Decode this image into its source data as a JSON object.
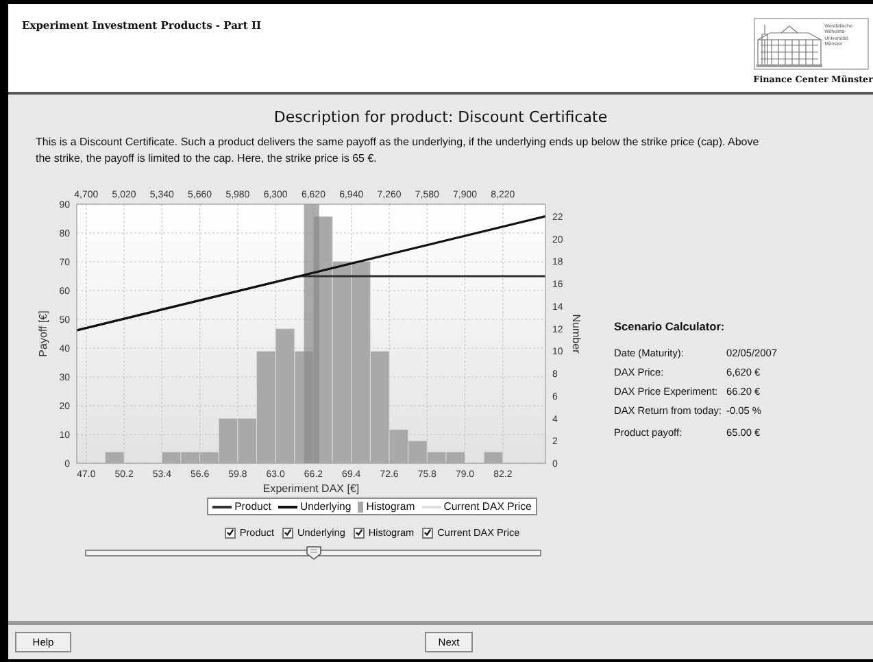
{
  "window": {
    "title": "Experiment Investment Products - Part II"
  },
  "logo": {
    "lines": [
      "Westfälische",
      "Wilhelms-Universität",
      "Münster"
    ],
    "caption": "Finance Center Münster"
  },
  "heading": "Description for product: Discount Certificate",
  "description": "This is a Discount Certificate. Such a product delivers the same payoff as the underlying, if the underlying ends up below the strike price (cap). Above the strike, the payoff is limited to the cap. Here, the strike price is 65 €.",
  "histogram": {
    "chart_data": {
      "type": "bar",
      "xlabel": "Experiment DAX [€]",
      "ylabel": "Number",
      "x": [
        47.8,
        49.4,
        51.0,
        52.6,
        54.2,
        55.8,
        57.4,
        59.0,
        60.6,
        62.2,
        63.8,
        65.4,
        67.0,
        68.6,
        70.2,
        71.8,
        73.4,
        75.0,
        76.6,
        78.2,
        79.8,
        81.4,
        83.0,
        84.6
      ],
      "series": [
        {
          "name": "Histogram",
          "color": "#a9a9a9",
          "values": [
            0,
            1,
            0,
            0,
            1,
            1,
            1,
            4,
            4,
            10,
            12,
            10,
            22,
            18,
            18,
            10,
            3,
            2,
            1,
            1,
            0,
            1,
            0,
            0
          ]
        }
      ],
      "xlim": [
        46.2,
        85.8
      ],
      "ylim": [
        0,
        23.1
      ],
      "xticks": [
        {
          "value": 47.0,
          "label": "47.0"
        },
        {
          "value": 50.2,
          "label": "50.2"
        },
        {
          "value": 53.4,
          "label": "53.4"
        },
        {
          "value": 56.6,
          "label": "56.6"
        },
        {
          "value": 59.8,
          "label": "59.8"
        },
        {
          "value": 63.0,
          "label": "63.0"
        },
        {
          "value": 66.2,
          "label": "66.2"
        },
        {
          "value": 69.4,
          "label": "69.4"
        },
        {
          "value": 72.6,
          "label": "72.6"
        },
        {
          "value": 75.8,
          "label": "75.8"
        },
        {
          "value": 79.0,
          "label": "79.0"
        },
        {
          "value": 82.2,
          "label": "82.2"
        }
      ],
      "yticks": [
        0,
        2,
        4,
        6,
        8,
        10,
        12,
        14,
        16,
        18,
        20,
        22
      ],
      "ref_lines": [
        {
          "axis": "x",
          "value": 66.2,
          "label": "Current DAX Price"
        }
      ]
    }
  },
  "payoff_chart": {
    "chart_data": {
      "type": "line",
      "ylabel": "Payoff [€]",
      "x": [
        4620,
        6500,
        8580
      ],
      "series": [
        {
          "name": "Product",
          "color": "#333333",
          "values": [
            46.2,
            65,
            65
          ]
        },
        {
          "name": "Underlying",
          "color": "#111111",
          "values": [
            46.2,
            65,
            85.8
          ]
        }
      ],
      "xlim": [
        4620,
        8580
      ],
      "ylim": [
        0,
        90
      ],
      "grid": true,
      "xticks": [
        {
          "value": 4700,
          "label": "4,700"
        },
        {
          "value": 5020,
          "label": "5,020"
        },
        {
          "value": 5340,
          "label": "5,340"
        },
        {
          "value": 5660,
          "label": "5,660"
        },
        {
          "value": 5980,
          "label": "5,980"
        },
        {
          "value": 6300,
          "label": "6,300"
        },
        {
          "value": 6620,
          "label": "6,620"
        },
        {
          "value": 6940,
          "label": "6,940"
        },
        {
          "value": 7260,
          "label": "7,260"
        },
        {
          "value": 7580,
          "label": "7,580"
        },
        {
          "value": 7900,
          "label": "7,900"
        },
        {
          "value": 8220,
          "label": "8,220"
        }
      ],
      "yticks": [
        0,
        10,
        20,
        30,
        40,
        50,
        60,
        70,
        80,
        90
      ]
    }
  },
  "toggles": [
    {
      "label": "Product",
      "checked": true
    },
    {
      "label": "Underlying",
      "checked": true
    },
    {
      "label": "Histogram",
      "checked": true
    },
    {
      "label": "Current DAX Price",
      "checked": true
    }
  ],
  "slider": {
    "level": 0.5
  },
  "calculator": {
    "title": "Scenario Calculator:",
    "rows": [
      {
        "label": "Date (Maturity):",
        "value": "02/05/2007"
      },
      {
        "label": "DAX Price:",
        "value": "6,620 €"
      },
      {
        "label": "DAX Price Experiment:",
        "value": "66.20 €"
      },
      {
        "label": "DAX Return from today:",
        "value": "-0.05 %"
      },
      {
        "label": "Product payoff:",
        "value": "65.00 €",
        "kind": "result"
      }
    ]
  },
  "buttons": [
    {
      "label": "Help"
    },
    {
      "label": "Next"
    }
  ]
}
